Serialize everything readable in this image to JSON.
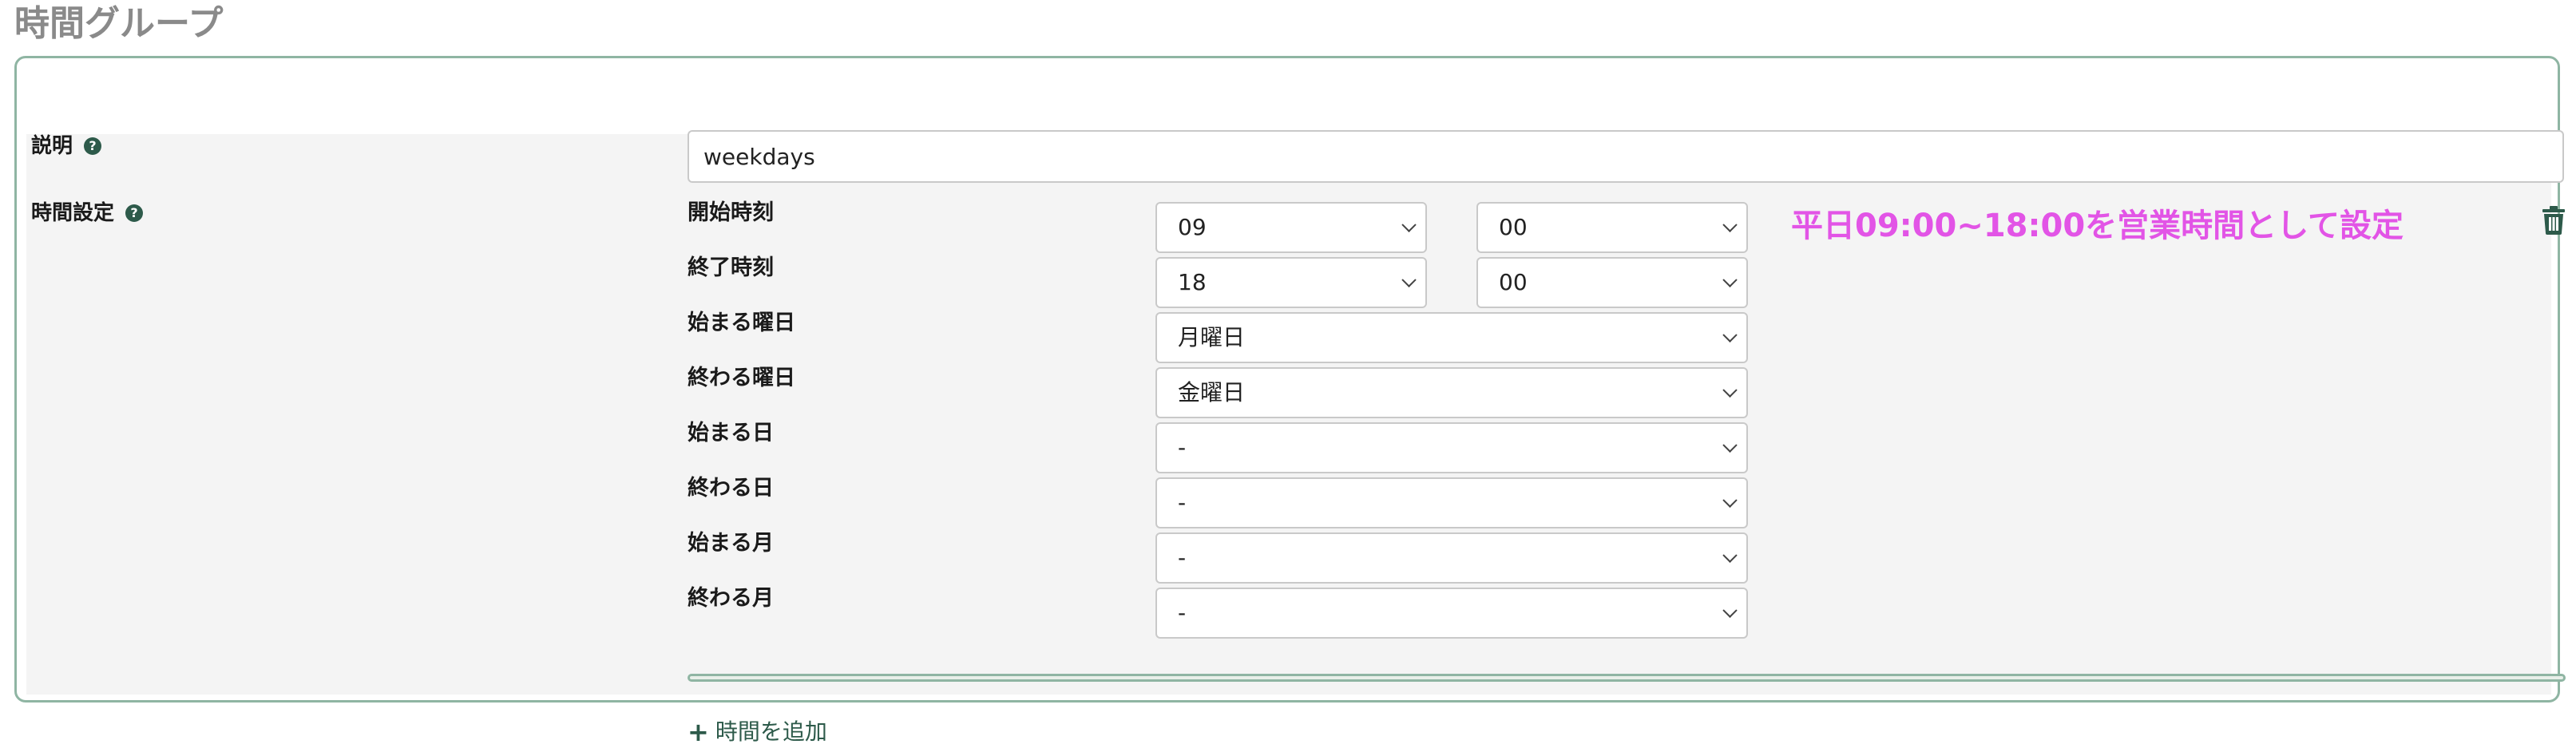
{
  "page": {
    "title": "時間グループ"
  },
  "description": {
    "label": "説明",
    "value": "weekdays"
  },
  "time_settings": {
    "label": "時間設定",
    "start_time": {
      "label": "開始時刻",
      "hour": "09",
      "minute": "00"
    },
    "end_time": {
      "label": "終了時刻",
      "hour": "18",
      "minute": "00"
    },
    "start_weekday": {
      "label": "始まる曜日",
      "value": "月曜日"
    },
    "end_weekday": {
      "label": "終わる曜日",
      "value": "金曜日"
    },
    "start_day": {
      "label": "始まる日",
      "value": "-"
    },
    "end_day": {
      "label": "終わる日",
      "value": "-"
    },
    "start_month": {
      "label": "始まる月",
      "value": "-"
    },
    "end_month": {
      "label": "終わる月",
      "value": "-"
    },
    "annotation": "平日09:00~18:00を営業時間として設定",
    "add_label": "時間を追加"
  },
  "icons": {
    "help": "question-circle-icon",
    "delete": "trash-icon",
    "add": "plus-icon",
    "dropdown": "chevron-down-icon"
  },
  "colors": {
    "accent": "#2d5a4a",
    "panel_border": "#8fb5a3",
    "annotation": "#e254e6",
    "title": "#8a8a8a"
  }
}
